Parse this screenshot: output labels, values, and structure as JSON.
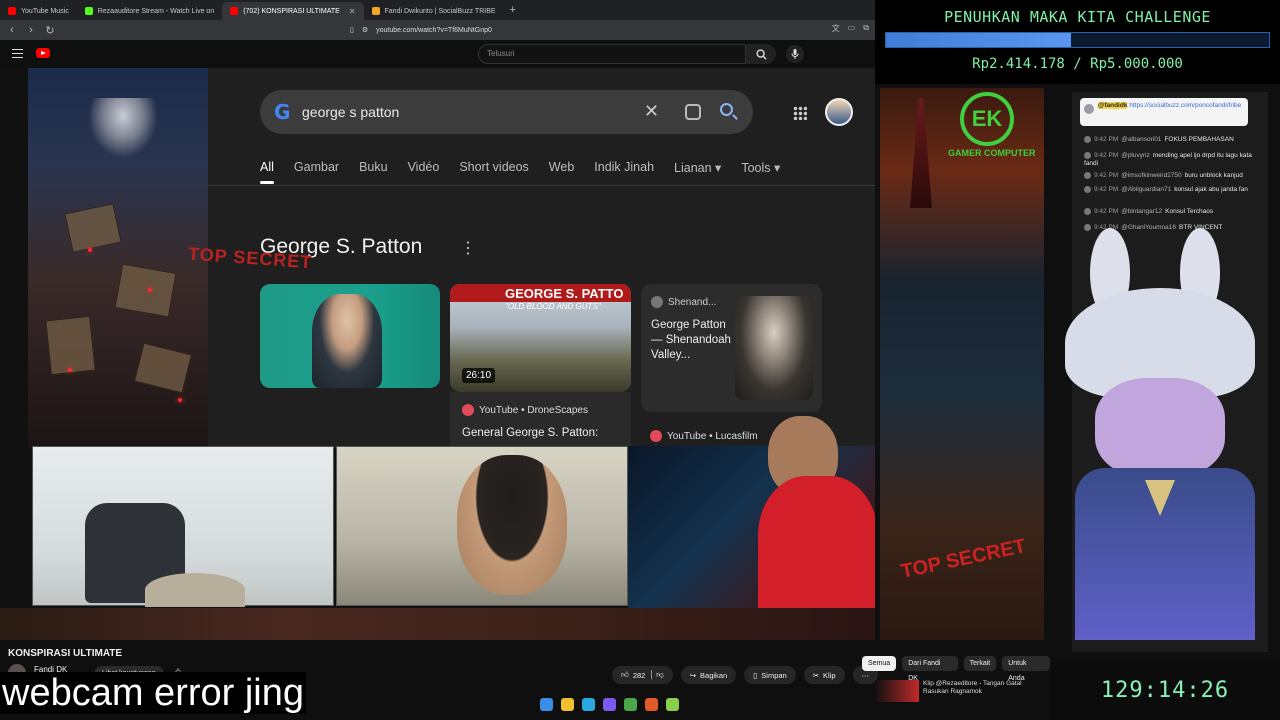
{
  "browser": {
    "tabs": [
      {
        "label": "YouTube Music",
        "color": "#ff0000"
      },
      {
        "label": "Rezaauditore Stream - Watch Live on",
        "color": "#53fc18"
      },
      {
        "label": "(702) KONSPIRASI ULTIMATE",
        "color": "#ff0000",
        "active": true
      },
      {
        "label": "Fandi Dwikunto | SocialBuzz TRIBE",
        "color": "#f5a623"
      }
    ],
    "new_tab": "+",
    "url": "youtube.com/watch?v=Tf6MuNtGnp0"
  },
  "youtube": {
    "search_placeholder": "Telusuri",
    "video_title": "KONSPIRASI ULTIMATE",
    "channel": "Fandi DK",
    "join_button": "Lihat keuntungan",
    "likes": "282",
    "share": "Bagikan",
    "save": "Simpan",
    "clip": "Klip",
    "chips": [
      "Semua",
      "Dari Fandi DK",
      "Terkait",
      "Untuk Anda"
    ],
    "recommendation": "Klip @Rezaeditore - Tangan Gatal Rasukan Ragnamok"
  },
  "google": {
    "query": "george s patton",
    "tabs": [
      "All",
      "Gambar",
      "Buku",
      "Vidéo",
      "Short videos",
      "Web",
      "Indik Jinah",
      "Lianan ▾",
      "Tools ▾"
    ],
    "panel_title": "George S. Patton",
    "tile2_heading": "GEORGE S. PATTO",
    "tile2_sub": "\"OLD BLOOD AND GUTS\"",
    "tile2_duration": "26:10",
    "tile2_source": "YouTube • DroneScapes",
    "tile2_title": "General George S. Patton:",
    "tile3_source": "Shenand...",
    "tile3_title": "George Patton — Shenandoah Valley...",
    "tile4_source": "YouTube • Lucasfilm"
  },
  "overlay": {
    "challenge_title": "PENUHKAN MAKA KITA CHALLENGE",
    "progress_fraction": 0.483,
    "challenge_amount": "Rp2.414.178 / Rp5.000.000",
    "timer": "129:14:26",
    "poster_logo": "EK",
    "poster_text": "GAMER COMPUTER",
    "stamp": "TOP SECRET"
  },
  "chat": {
    "pinned_user": "@fandidk",
    "pinned_link": "https://socialbuzz.com/poncofandi/tribe",
    "messages": [
      {
        "time": "9:42 PM",
        "user": "@albansori01",
        "text": "FOKUS PEMBAHASAN"
      },
      {
        "time": "9:42 PM",
        "user": "@pluvyriz",
        "text": "mending apel ijo drpd itu lagu kata fandi"
      },
      {
        "time": "9:42 PM",
        "user": "@imsofkinweird2750",
        "text": "buru unblock kanjud"
      },
      {
        "time": "9:42 PM",
        "user": "@Abilguardian71",
        "text": "konsul ajak abu janda fan"
      },
      {
        "time": "9:42 PM",
        "user": "@bintangar12",
        "text": "Konsul Terchaos"
      },
      {
        "time": "9:42 PM",
        "user": "@GhaniYoumna16",
        "text": "BTR VINCENT"
      }
    ]
  },
  "caption": "webcam error jing"
}
